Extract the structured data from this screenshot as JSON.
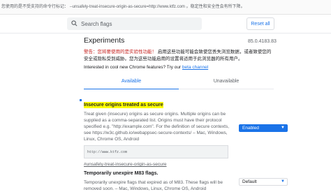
{
  "banner": {
    "lead": "您使用的是不受支持的命令行标记：",
    "flag": "--unsafely-treat-insecure-origin-as-secure=http://www.ktfz.com",
    "tail": "。稳定性和安全性会有所下降。"
  },
  "header": {
    "search_placeholder": "Search flags",
    "reset_label": "Reset all"
  },
  "page": {
    "title": "Experiments",
    "version": "85.0.4183.83",
    "warning_red": "警告：您将要使用的是实验性功能！",
    "warning_rest": "启用这些功能可能会致使您丢失浏览数据，或者致使您的安全或隐私受到威胁。您为这些功能启用的设置将适用于此浏览器的所有用户。",
    "interest_text": "Interested in cool new Chrome features? Try our",
    "interest_link": "beta channel"
  },
  "tabs": {
    "available": "Available",
    "unavailable": "Unavailable"
  },
  "flags": [
    {
      "name": "Insecure origins treated as secure",
      "description": "Treat given (insecure) origins as secure origins. Multiple origins can be supplied as a comma-separated list. Origins must have their protocol specified e.g. \"http://example.com\". For the definition of secure contexts, see https://w3c.github.io/webappsec-secure-contexts/ – Mac, Windows, Linux, Chrome OS, Android",
      "input_value": "http://www.ktfz.com",
      "link": "#unsafely-treat-insecure-origin-as-secure",
      "state": "Enabled"
    },
    {
      "name": "Temporarily unexpire M83 flags.",
      "description": "Temporarily unexpire flags that expired as of M83. These flags will be removed soon. – Mac, Windows, Linux, Chrome OS, Android",
      "state": "Default"
    }
  ],
  "colors": {
    "accent": "#1a73e8",
    "warning_red": "#c5221f",
    "highlight": "#ffff00"
  }
}
